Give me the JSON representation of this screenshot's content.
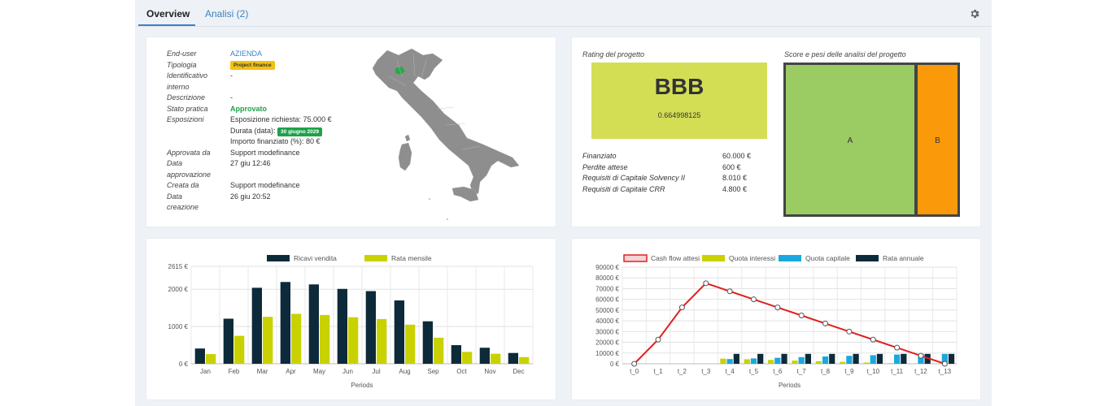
{
  "tabs": {
    "overview": "Overview",
    "analisi": "Analisi (2)"
  },
  "icons": {
    "settings": "gear-icon"
  },
  "colors": {
    "accent": "#3b83c4",
    "approved": "#1fa14a",
    "pill_yellow": "#f2c112",
    "rating_bg": "#d4de55",
    "score_a": "#9acc63",
    "score_b": "#fa9a0a"
  },
  "info": {
    "end_user_label": "End-user",
    "end_user_value": "AZIENDA",
    "tipologia_label": "Tipologia",
    "tipologia_value": "Project finance",
    "identificativo_label_1": "Identificativo",
    "identificativo_label_2": "interno",
    "identificativo_value": "-",
    "descrizione_label": "Descrizione",
    "descrizione_value": "-",
    "stato_label": "Stato pratica",
    "stato_value": "Approvato",
    "esposizioni_label": "Esposizioni",
    "esposizione_richiesta": "Esposizione richiesta: 75.000 €",
    "durata_label": "Durata (data):",
    "durata_value": "30 giugno 2029",
    "importo_finanziato": "Importo finanziato (%): 80 €",
    "approvata_da_label": "Approvata da",
    "approvata_da_value": "Support modefinance",
    "data_approvazione_label_1": "Data",
    "data_approvazione_label_2": "approvazione",
    "data_approvazione_value": "27 giu 12:46",
    "creata_da_label": "Creata da",
    "creata_da_value": "Support modefinance",
    "data_creazione_label_1": "Data",
    "data_creazione_label_2": "creazione",
    "data_creazione_value": "26 giu 20:52"
  },
  "rating": {
    "title": "Rating del progetto",
    "grade": "BBB",
    "score": "0.664998125",
    "rows": [
      {
        "label": "Finanziato",
        "value": "60.000 €"
      },
      {
        "label": "Perdite attese",
        "value": "600 €"
      },
      {
        "label": "Requisiti di Capitale Solvency II",
        "value": "8.010 €"
      },
      {
        "label": "Requisiti di Capitale CRR",
        "value": "4.800 €"
      }
    ]
  },
  "score": {
    "title": "Score e pesi delle analisi del progetto",
    "a_label": "A",
    "b_label": "B"
  },
  "chart_data": [
    {
      "type": "bar",
      "categories": [
        "Jan",
        "Feb",
        "Mar",
        "Apr",
        "May",
        "Jun",
        "Jul",
        "Aug",
        "Sep",
        "Oct",
        "Nov",
        "Dec"
      ],
      "series": [
        {
          "name": "Ricavi vendita",
          "color": "#0d2a3a",
          "values": [
            410,
            1210,
            2040,
            2195,
            2130,
            2010,
            1950,
            1700,
            1140,
            500,
            430,
            290
          ]
        },
        {
          "name": "Rata mensile",
          "color": "#c9d200",
          "values": [
            260,
            750,
            1260,
            1340,
            1310,
            1250,
            1200,
            1050,
            700,
            320,
            270,
            180
          ]
        }
      ],
      "y_ticks": [
        "2615 €",
        "2000 €",
        "1000 €",
        "0 €"
      ],
      "y_tick_values": [
        2615,
        2000,
        1000,
        0
      ],
      "ylim": [
        0,
        2615
      ],
      "xlabel": "Periods",
      "grid": true,
      "legend": "top-center"
    },
    {
      "type": "bar",
      "categories": [
        "t_0",
        "t_1",
        "t_2",
        "t_3",
        "t_4",
        "t_5",
        "t_6",
        "t_7",
        "t_8",
        "t_9",
        "t_10",
        "t_11",
        "t_12",
        "t_13"
      ],
      "series": [
        {
          "name": "Cash flow attesi",
          "type": "line",
          "color": "#e02020",
          "values": [
            0,
            22500,
            52500,
            75000,
            67500,
            60000,
            52500,
            45000,
            37500,
            30000,
            22500,
            15000,
            7500,
            0
          ]
        },
        {
          "name": "Quota interessi",
          "color": "#c9d200",
          "values": [
            null,
            null,
            null,
            null,
            4800,
            4200,
            3600,
            3000,
            2400,
            1800,
            1200,
            600,
            0,
            0
          ]
        },
        {
          "name": "Quota capitale",
          "color": "#1aa8e0",
          "values": [
            null,
            null,
            null,
            null,
            4400,
            5000,
            5600,
            6200,
            6800,
            7400,
            8000,
            8600,
            9200,
            9200
          ]
        },
        {
          "name": "Rata annuale",
          "color": "#0d2a3a",
          "values": [
            null,
            null,
            null,
            null,
            9200,
            9200,
            9200,
            9200,
            9200,
            9200,
            9200,
            9200,
            9200,
            9200
          ]
        }
      ],
      "y_ticks": [
        "90000 €",
        "80000 €",
        "70000 €",
        "60000 €",
        "50000 €",
        "40000 €",
        "30000 €",
        "20000 €",
        "10000 €",
        "0 €"
      ],
      "y_tick_values": [
        90000,
        80000,
        70000,
        60000,
        50000,
        40000,
        30000,
        20000,
        10000,
        0
      ],
      "ylim": [
        0,
        90000
      ],
      "xlabel": "Periods",
      "grid": true,
      "legend": "top-center"
    }
  ]
}
